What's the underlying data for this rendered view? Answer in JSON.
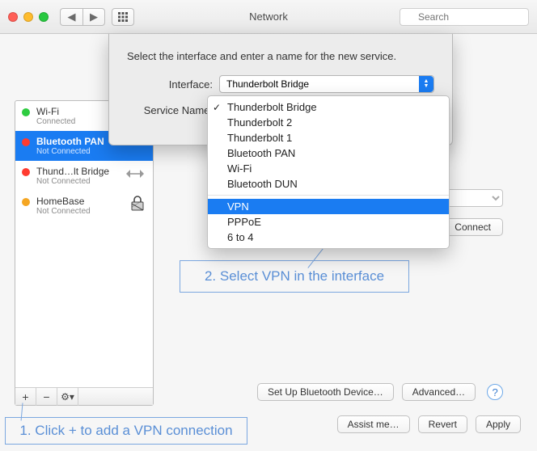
{
  "window": {
    "title": "Network"
  },
  "search": {
    "placeholder": "Search"
  },
  "sidebar": {
    "items": [
      {
        "name": "Wi-Fi",
        "status": "Connected",
        "color": "green",
        "selected": false,
        "icon": ""
      },
      {
        "name": "Bluetooth PAN",
        "status": "Not Connected",
        "color": "red",
        "selected": true,
        "icon": ""
      },
      {
        "name": "Thund…lt Bridge",
        "status": "Not Connected",
        "color": "red",
        "selected": false,
        "icon": "bridge"
      },
      {
        "name": "HomeBase",
        "status": "Not Connected",
        "color": "orange",
        "selected": false,
        "icon": "lock"
      }
    ]
  },
  "sheet": {
    "prompt": "Select the interface and enter a name for the new service.",
    "interface_label": "Interface:",
    "service_name_label": "Service Name:",
    "menu": {
      "checked": "Thunderbolt Bridge",
      "highlighted": "VPN",
      "items": [
        "Thunderbolt Bridge",
        "Thunderbolt 2",
        "Thunderbolt 1",
        "Bluetooth PAN",
        "Wi-Fi",
        "Bluetooth DUN"
      ],
      "items2": [
        "VPN",
        "PPPoE",
        "6 to 4"
      ]
    }
  },
  "right": {
    "connect": "Connect",
    "setup": "Set Up Bluetooth Device…",
    "advanced": "Advanced…"
  },
  "bottom": {
    "assist": "Assist me…",
    "revert": "Revert",
    "apply": "Apply"
  },
  "annotations": {
    "a1": "1. Click + to add a VPN connection",
    "a2": "2. Select VPN in the interface"
  }
}
